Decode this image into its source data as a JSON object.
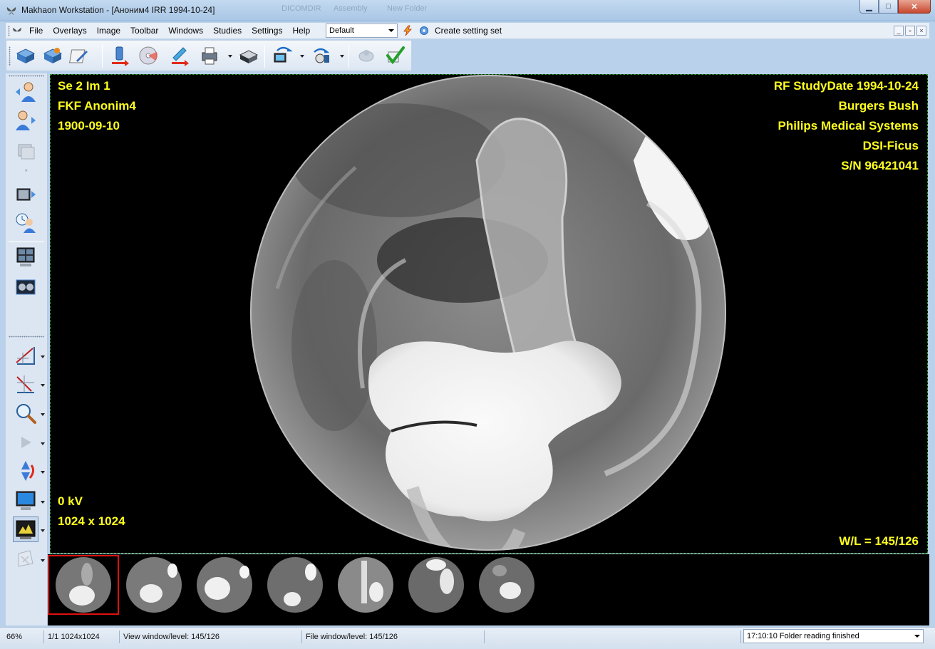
{
  "window": {
    "title": "Makhaon Workstation - [Аноним4 IRR 1994-10-24]",
    "background_tabs": [
      "DICOMDIR",
      "Assembly",
      "New Folder"
    ]
  },
  "menu": {
    "items": [
      "File",
      "Overlays",
      "Image",
      "Toolbar",
      "Windows",
      "Studies",
      "Settings",
      "Help"
    ],
    "preset": "Default",
    "create_setting": "Create setting set"
  },
  "overlay": {
    "top_left": [
      "Se 2 Im 1",
      "FKF Anonim4",
      "1900-09-10"
    ],
    "top_right": [
      "RF StudyDate 1994-10-24",
      "Burgers Bush",
      "Philips Medical Systems",
      "DSI-Ficus",
      "S/N 96421041"
    ],
    "bottom_left": [
      "0 kV",
      "1024 x 1024"
    ],
    "bottom_right": "W/L = 145/126"
  },
  "status": {
    "zoom": "66%",
    "frame": "1/1 1024x1024",
    "view_wl": "View window/level: 145/126",
    "file_wl": "File window/level: 145/126",
    "log": "17:10:10 Folder reading finished"
  },
  "colors": {
    "overlay_text": "#ffff1f",
    "viewport_border": "#2fa12f",
    "selected_thumb": "#e01010"
  }
}
